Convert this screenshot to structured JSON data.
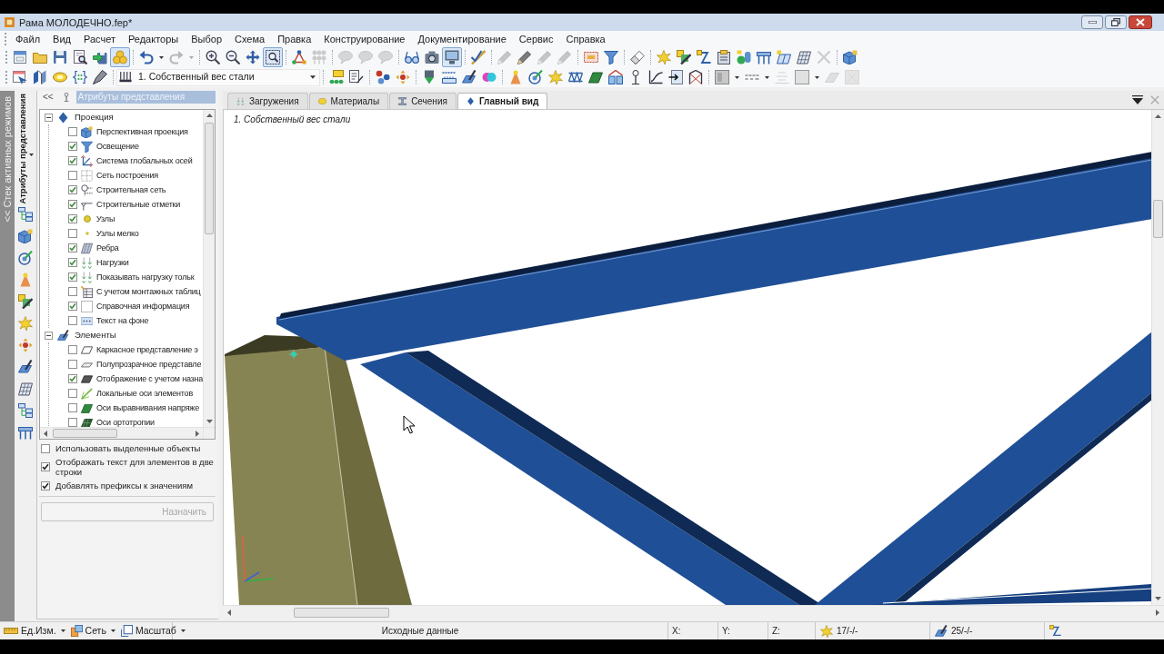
{
  "window": {
    "title": "Рама МОЛОДЕЧНО.fep*"
  },
  "menu": [
    "Файл",
    "Вид",
    "Расчет",
    "Редакторы",
    "Выбор",
    "Схема",
    "Правка",
    "Конструирование",
    "Документирование",
    "Сервис",
    "Справка"
  ],
  "toolbars": [
    {
      "groups": [
        [
          {
            "kind": "button",
            "disabled": false,
            "pressed": false
          },
          {
            "kind": "button",
            "disabled": false,
            "pressed": false
          },
          {
            "kind": "button",
            "disabled": false,
            "pressed": false
          },
          {
            "kind": "button",
            "disabled": false,
            "pressed": false
          },
          {
            "kind": "button",
            "disabled": false,
            "pressed": false
          },
          {
            "kind": "button",
            "disabled": false,
            "pressed": true
          }
        ],
        [
          {
            "kind": "split",
            "disabled": false,
            "pressed": false
          },
          {
            "kind": "split",
            "disabled": true,
            "pressed": false
          }
        ],
        [
          {
            "kind": "button",
            "disabled": false,
            "pressed": false
          },
          {
            "kind": "button",
            "disabled": false,
            "pressed": false
          },
          {
            "kind": "button",
            "disabled": false,
            "pressed": false
          },
          {
            "kind": "button",
            "disabled": false,
            "pressed": true
          }
        ],
        [
          {
            "kind": "button",
            "disabled": false,
            "pressed": false
          },
          {
            "kind": "button",
            "disabled": true,
            "pressed": false
          }
        ],
        [
          {
            "kind": "button",
            "disabled": true,
            "pressed": false
          },
          {
            "kind": "button",
            "disabled": true,
            "pressed": false
          },
          {
            "kind": "button",
            "disabled": true,
            "pressed": false
          }
        ],
        [
          {
            "kind": "button",
            "disabled": false,
            "pressed": false
          },
          {
            "kind": "button",
            "disabled": false,
            "pressed": false
          },
          {
            "kind": "button",
            "disabled": false,
            "pressed": true
          }
        ],
        [
          {
            "kind": "button",
            "disabled": false,
            "pressed": false
          }
        ],
        [
          {
            "kind": "button",
            "disabled": true,
            "pressed": false
          },
          {
            "kind": "button",
            "disabled": false,
            "pressed": false
          },
          {
            "kind": "button",
            "disabled": true,
            "pressed": false
          },
          {
            "kind": "button",
            "disabled": true,
            "pressed": false
          }
        ],
        [
          {
            "kind": "button",
            "disabled": false,
            "pressed": false
          },
          {
            "kind": "button",
            "disabled": false,
            "pressed": false
          }
        ],
        [
          {
            "kind": "button",
            "disabled": false,
            "pressed": false
          }
        ],
        [
          {
            "kind": "button",
            "disabled": false,
            "pressed": false
          },
          {
            "kind": "button",
            "disabled": false,
            "pressed": false
          },
          {
            "kind": "button",
            "disabled": false,
            "pressed": false
          },
          {
            "kind": "button",
            "disabled": false,
            "pressed": false
          },
          {
            "kind": "button",
            "disabled": false,
            "pressed": false
          },
          {
            "kind": "button",
            "disabled": false,
            "pressed": false
          },
          {
            "kind": "button",
            "disabled": false,
            "pressed": false
          },
          {
            "kind": "button",
            "disabled": false,
            "pressed": false
          },
          {
            "kind": "button",
            "disabled": true,
            "pressed": false
          }
        ],
        [
          {
            "kind": "button",
            "disabled": false,
            "pressed": false
          }
        ]
      ]
    },
    {
      "groups": [
        [
          {
            "kind": "button",
            "disabled": false,
            "pressed": false
          },
          {
            "kind": "button",
            "disabled": false,
            "pressed": false
          },
          {
            "kind": "button",
            "disabled": false,
            "pressed": false
          },
          {
            "kind": "button",
            "disabled": false,
            "pressed": false
          },
          {
            "kind": "button",
            "disabled": false,
            "pressed": false
          }
        ],
        [
          {
            "kind": "combo",
            "disabled": false,
            "pressed": false,
            "value": "1. Собственный вес стали"
          }
        ],
        [
          {
            "kind": "button",
            "disabled": false,
            "pressed": false
          },
          {
            "kind": "button",
            "disabled": false,
            "pressed": false
          }
        ],
        [
          {
            "kind": "button",
            "disabled": false,
            "pressed": false
          },
          {
            "kind": "button",
            "disabled": false,
            "pressed": false
          }
        ],
        [
          {
            "kind": "button",
            "disabled": false,
            "pressed": false
          },
          {
            "kind": "button",
            "disabled": false,
            "pressed": false
          },
          {
            "kind": "button",
            "disabled": false,
            "pressed": false
          },
          {
            "kind": "button",
            "disabled": false,
            "pressed": false
          }
        ],
        [
          {
            "kind": "button",
            "disabled": false,
            "pressed": false
          },
          {
            "kind": "button",
            "disabled": false,
            "pressed": false
          },
          {
            "kind": "button",
            "disabled": false,
            "pressed": false
          },
          {
            "kind": "button",
            "disabled": false,
            "pressed": false
          },
          {
            "kind": "button",
            "disabled": false,
            "pressed": false
          },
          {
            "kind": "button",
            "disabled": false,
            "pressed": false
          },
          {
            "kind": "button",
            "disabled": false,
            "pressed": false
          },
          {
            "kind": "button",
            "disabled": false,
            "pressed": false
          },
          {
            "kind": "button",
            "disabled": false,
            "pressed": false
          },
          {
            "kind": "button",
            "disabled": false,
            "pressed": false
          }
        ],
        [
          {
            "kind": "split",
            "disabled": false,
            "pressed": false
          },
          {
            "kind": "split",
            "disabled": false,
            "pressed": false
          },
          {
            "kind": "button",
            "disabled": true,
            "pressed": false
          },
          {
            "kind": "split",
            "disabled": false,
            "pressed": false
          },
          {
            "kind": "button",
            "disabled": true,
            "pressed": false
          },
          {
            "kind": "button",
            "disabled": true,
            "pressed": false
          }
        ]
      ]
    }
  ],
  "side_tabs": {
    "stack": "<< Стек активных режимов",
    "attributes": "Атрибуты представления"
  },
  "panel": {
    "collapse": "<<",
    "title": "Атрибуты представления",
    "tree": [
      {
        "label": "Проекция",
        "expanded": true,
        "children": [
          {
            "label": "Перспективная проекция",
            "checked": false
          },
          {
            "label": "Освещение",
            "checked": true
          },
          {
            "label": "Система глобальных осей",
            "checked": true
          },
          {
            "label": "Сеть построения",
            "checked": false
          },
          {
            "label": "Строительная сеть",
            "checked": true
          },
          {
            "label": "Строительные отметки",
            "checked": true
          },
          {
            "label": "Узлы",
            "checked": true
          },
          {
            "label": "Узлы мелко",
            "checked": false
          },
          {
            "label": "Ребра",
            "checked": true
          },
          {
            "label": "Нагрузки",
            "checked": true
          },
          {
            "label": "Показывать нагрузку тольк",
            "checked": true
          },
          {
            "label": "С учетом монтажных таблиц",
            "checked": false
          },
          {
            "label": "Справочная информация",
            "checked": true
          },
          {
            "label": "Текст на фоне",
            "checked": false
          }
        ]
      },
      {
        "label": "Элементы",
        "expanded": true,
        "children": [
          {
            "label": "Каркасное представление э",
            "checked": false
          },
          {
            "label": "Полупрозрачное представле",
            "checked": false
          },
          {
            "label": "Отображение с учетом назна",
            "checked": true
          },
          {
            "label": "Локальные оси элементов",
            "checked": false
          },
          {
            "label": "Оси выравнивания напряже",
            "checked": false
          },
          {
            "label": "Оси ортотропии",
            "checked": false
          }
        ]
      }
    ],
    "options": [
      {
        "label": "Использовать выделенные объекты",
        "checked": false
      },
      {
        "label": "Отображать текст для элементов в две строки",
        "checked": true
      },
      {
        "label": "Добавлять префиксы к значениям",
        "checked": true
      }
    ],
    "assign_button": {
      "label": "Назначить",
      "disabled": true
    }
  },
  "tabs": [
    {
      "label": "Загружения",
      "selected": false
    },
    {
      "label": "Материалы",
      "selected": false
    },
    {
      "label": "Сечения",
      "selected": false
    },
    {
      "label": "Главный вид",
      "selected": true
    }
  ],
  "viewport": {
    "caption": "1. Собственный вес стали"
  },
  "status_bar": {
    "menus": [
      "Ед.Изм.",
      "Сеть",
      "Масштаб"
    ],
    "mode": "Исходные данные",
    "coords": [
      "X:",
      "Y:",
      "Z:"
    ],
    "counters": [
      "17/-/-",
      "25/-/-"
    ]
  }
}
